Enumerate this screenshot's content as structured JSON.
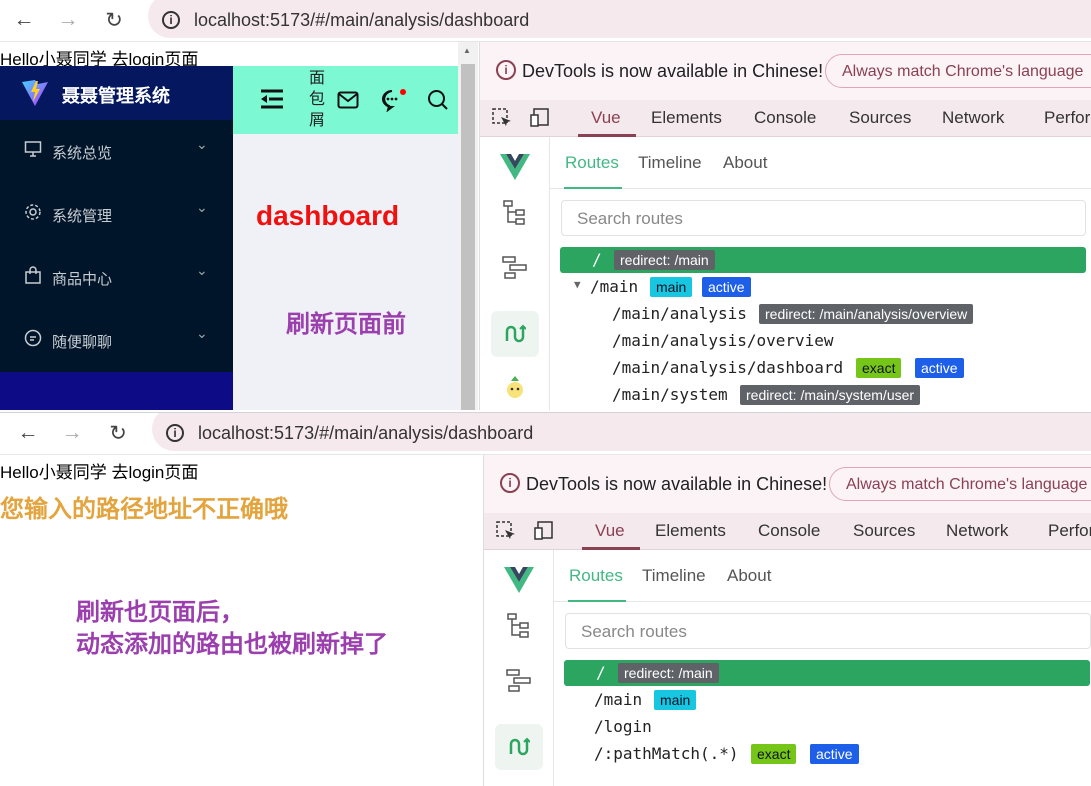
{
  "top": {
    "url": "localhost:5173/#/main/analysis/dashboard",
    "hello": "Hello小聂同学 去login页面",
    "logo_text": "聂聂管理系统",
    "menu": [
      {
        "label": "系统总览",
        "icon": "monitor-icon"
      },
      {
        "label": "系统管理",
        "icon": "gear-icon"
      },
      {
        "label": "商品中心",
        "icon": "bag-icon"
      },
      {
        "label": "随便聊聊",
        "icon": "chat-icon"
      }
    ],
    "breadcrumb": "面包屑",
    "dashboard_label": "dashboard",
    "annotation": "刷新页面前",
    "routes": [
      {
        "path": "/",
        "tags": [
          {
            "text": "redirect: /main",
            "style": "gray"
          }
        ],
        "selected": true,
        "indent": 0
      },
      {
        "path": "/main",
        "tags": [
          {
            "text": "main",
            "style": "cyan"
          },
          {
            "text": "active",
            "style": "blue"
          }
        ],
        "caret": true,
        "indent": 0
      },
      {
        "path": "/main/analysis",
        "tags": [
          {
            "text": "redirect: /main/analysis/overview",
            "style": "gray"
          }
        ],
        "indent": 1
      },
      {
        "path": "/main/analysis/overview",
        "tags": [],
        "indent": 1
      },
      {
        "path": "/main/analysis/dashboard",
        "tags": [
          {
            "text": "exact",
            "style": "green"
          },
          {
            "text": "active",
            "style": "blue"
          }
        ],
        "indent": 1
      },
      {
        "path": "/main/system",
        "tags": [
          {
            "text": "redirect: /main/system/user",
            "style": "gray"
          }
        ],
        "indent": 1
      }
    ]
  },
  "bottom": {
    "url": "localhost:5173/#/main/analysis/dashboard",
    "hello": "Hello小聂同学 去login页面",
    "not_found": "您输入的路径地址不正确哦",
    "annotation_line1": "刷新也页面后，",
    "annotation_line2": "动态添加的路由也被刷新掉了",
    "routes": [
      {
        "path": "/",
        "tags": [
          {
            "text": "redirect: /main",
            "style": "gray"
          }
        ],
        "selected": true,
        "indent": 0
      },
      {
        "path": "/main",
        "tags": [
          {
            "text": "main",
            "style": "cyan"
          }
        ],
        "indent": 0
      },
      {
        "path": "/login",
        "tags": [],
        "indent": 0
      },
      {
        "path": "/:pathMatch(.*)",
        "tags": [
          {
            "text": "exact",
            "style": "green"
          },
          {
            "text": "active",
            "style": "blue"
          }
        ],
        "indent": 0
      }
    ]
  },
  "devtools": {
    "notice": "DevTools is now available in Chinese!",
    "notice_button": "Always match Chrome's language",
    "tabs": [
      "Vue",
      "Elements",
      "Console",
      "Sources",
      "Network",
      "Perfor"
    ],
    "vue_tabs": [
      "Routes",
      "Timeline",
      "About"
    ],
    "search_placeholder": "Search routes"
  },
  "colors": {
    "menu_bg": "#001529",
    "logo_bg": "#04175f",
    "header_bg": "#7cf9d2",
    "route_selected": "#2ba55f",
    "vue_green": "#42b883"
  }
}
